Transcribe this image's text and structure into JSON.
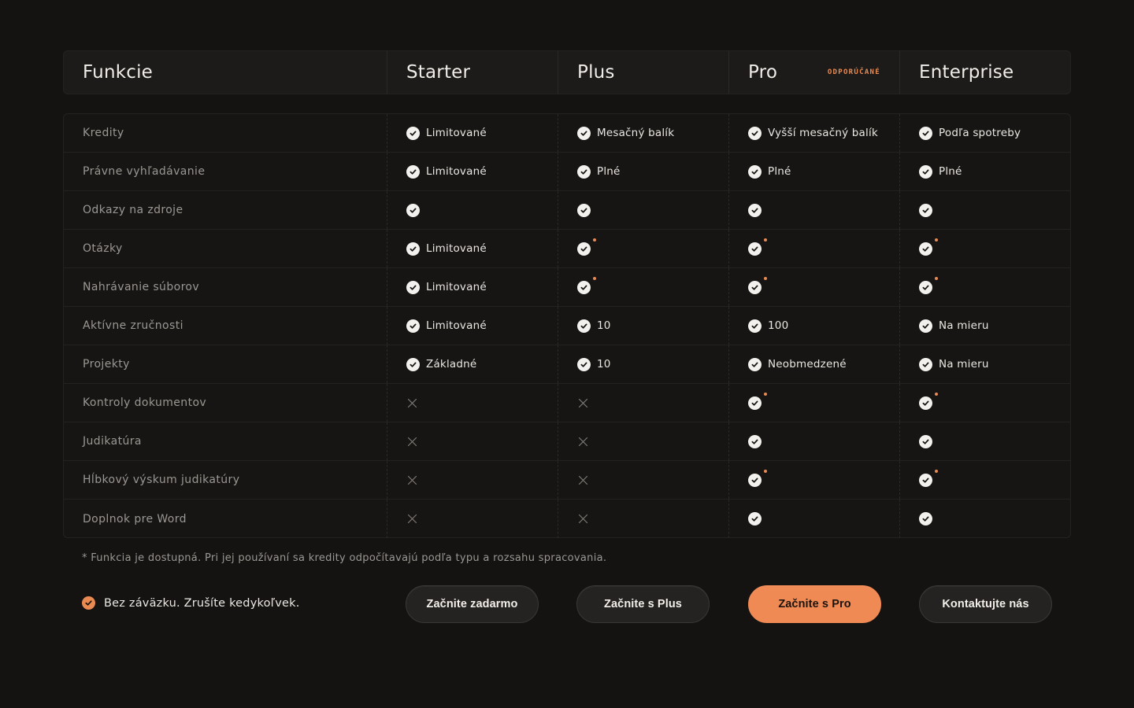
{
  "header": {
    "features_label": "Funkcie",
    "plans": [
      {
        "name": "Starter",
        "badge": ""
      },
      {
        "name": "Plus",
        "badge": ""
      },
      {
        "name": "Pro",
        "badge": "ODPORÚČANÉ"
      },
      {
        "name": "Enterprise",
        "badge": ""
      }
    ]
  },
  "rows": [
    {
      "feature": "Kredity",
      "cells": [
        {
          "type": "check",
          "text": "Limitované",
          "star": false
        },
        {
          "type": "check",
          "text": "Mesačný balík",
          "star": false
        },
        {
          "type": "check",
          "text": "Vyšší mesačný balík",
          "star": false
        },
        {
          "type": "check",
          "text": "Podľa spotreby",
          "star": false
        }
      ]
    },
    {
      "feature": "Právne vyhľadávanie",
      "cells": [
        {
          "type": "check",
          "text": "Limitované",
          "star": false
        },
        {
          "type": "check",
          "text": "Plné",
          "star": false
        },
        {
          "type": "check",
          "text": "Plné",
          "star": false
        },
        {
          "type": "check",
          "text": "Plné",
          "star": false
        }
      ]
    },
    {
      "feature": "Odkazy na zdroje",
      "cells": [
        {
          "type": "check",
          "text": "",
          "star": false
        },
        {
          "type": "check",
          "text": "",
          "star": false
        },
        {
          "type": "check",
          "text": "",
          "star": false
        },
        {
          "type": "check",
          "text": "",
          "star": false
        }
      ]
    },
    {
      "feature": "Otázky",
      "cells": [
        {
          "type": "check",
          "text": "Limitované",
          "star": false
        },
        {
          "type": "check",
          "text": "",
          "star": true
        },
        {
          "type": "check",
          "text": "",
          "star": true
        },
        {
          "type": "check",
          "text": "",
          "star": true
        }
      ]
    },
    {
      "feature": "Nahrávanie súborov",
      "cells": [
        {
          "type": "check",
          "text": "Limitované",
          "star": false
        },
        {
          "type": "check",
          "text": "",
          "star": true
        },
        {
          "type": "check",
          "text": "",
          "star": true
        },
        {
          "type": "check",
          "text": "",
          "star": true
        }
      ]
    },
    {
      "feature": "Aktívne zručnosti",
      "cells": [
        {
          "type": "check",
          "text": "Limitované",
          "star": false
        },
        {
          "type": "check",
          "text": "10",
          "star": false
        },
        {
          "type": "check",
          "text": "100",
          "star": false
        },
        {
          "type": "check",
          "text": "Na mieru",
          "star": false
        }
      ]
    },
    {
      "feature": "Projekty",
      "cells": [
        {
          "type": "check",
          "text": "Základné",
          "star": false
        },
        {
          "type": "check",
          "text": "10",
          "star": false
        },
        {
          "type": "check",
          "text": "Neobmedzené",
          "star": false
        },
        {
          "type": "check",
          "text": "Na mieru",
          "star": false
        }
      ]
    },
    {
      "feature": "Kontroly dokumentov",
      "cells": [
        {
          "type": "cross",
          "text": "",
          "star": false
        },
        {
          "type": "cross",
          "text": "",
          "star": false
        },
        {
          "type": "check",
          "text": "",
          "star": true
        },
        {
          "type": "check",
          "text": "",
          "star": true
        }
      ]
    },
    {
      "feature": "Judikatúra",
      "cells": [
        {
          "type": "cross",
          "text": "",
          "star": false
        },
        {
          "type": "cross",
          "text": "",
          "star": false
        },
        {
          "type": "check",
          "text": "",
          "star": false
        },
        {
          "type": "check",
          "text": "",
          "star": false
        }
      ]
    },
    {
      "feature": "Hĺbkový výskum judikatúry",
      "cells": [
        {
          "type": "cross",
          "text": "",
          "star": false
        },
        {
          "type": "cross",
          "text": "",
          "star": false
        },
        {
          "type": "check",
          "text": "",
          "star": true
        },
        {
          "type": "check",
          "text": "",
          "star": true
        }
      ]
    },
    {
      "feature": "Doplnok pre Word",
      "cells": [
        {
          "type": "cross",
          "text": "",
          "star": false
        },
        {
          "type": "cross",
          "text": "",
          "star": false
        },
        {
          "type": "check",
          "text": "",
          "star": false
        },
        {
          "type": "check",
          "text": "",
          "star": false
        }
      ]
    }
  ],
  "footnote": "* Funkcia je dostupná. Pri jej používaní sa kredity odpočítavajú podľa typu a rozsahu spracovania.",
  "commitment": "Bez záväzku. Zrušíte kedykoľvek.",
  "buttons": [
    {
      "label": "Začnite zadarmo",
      "primary": false
    },
    {
      "label": "Začnite s Plus",
      "primary": false
    },
    {
      "label": "Začnite s Pro",
      "primary": true
    },
    {
      "label": "Kontaktujte nás",
      "primary": false
    }
  ],
  "colors": {
    "accent": "#ef8a55",
    "background": "#141312"
  }
}
